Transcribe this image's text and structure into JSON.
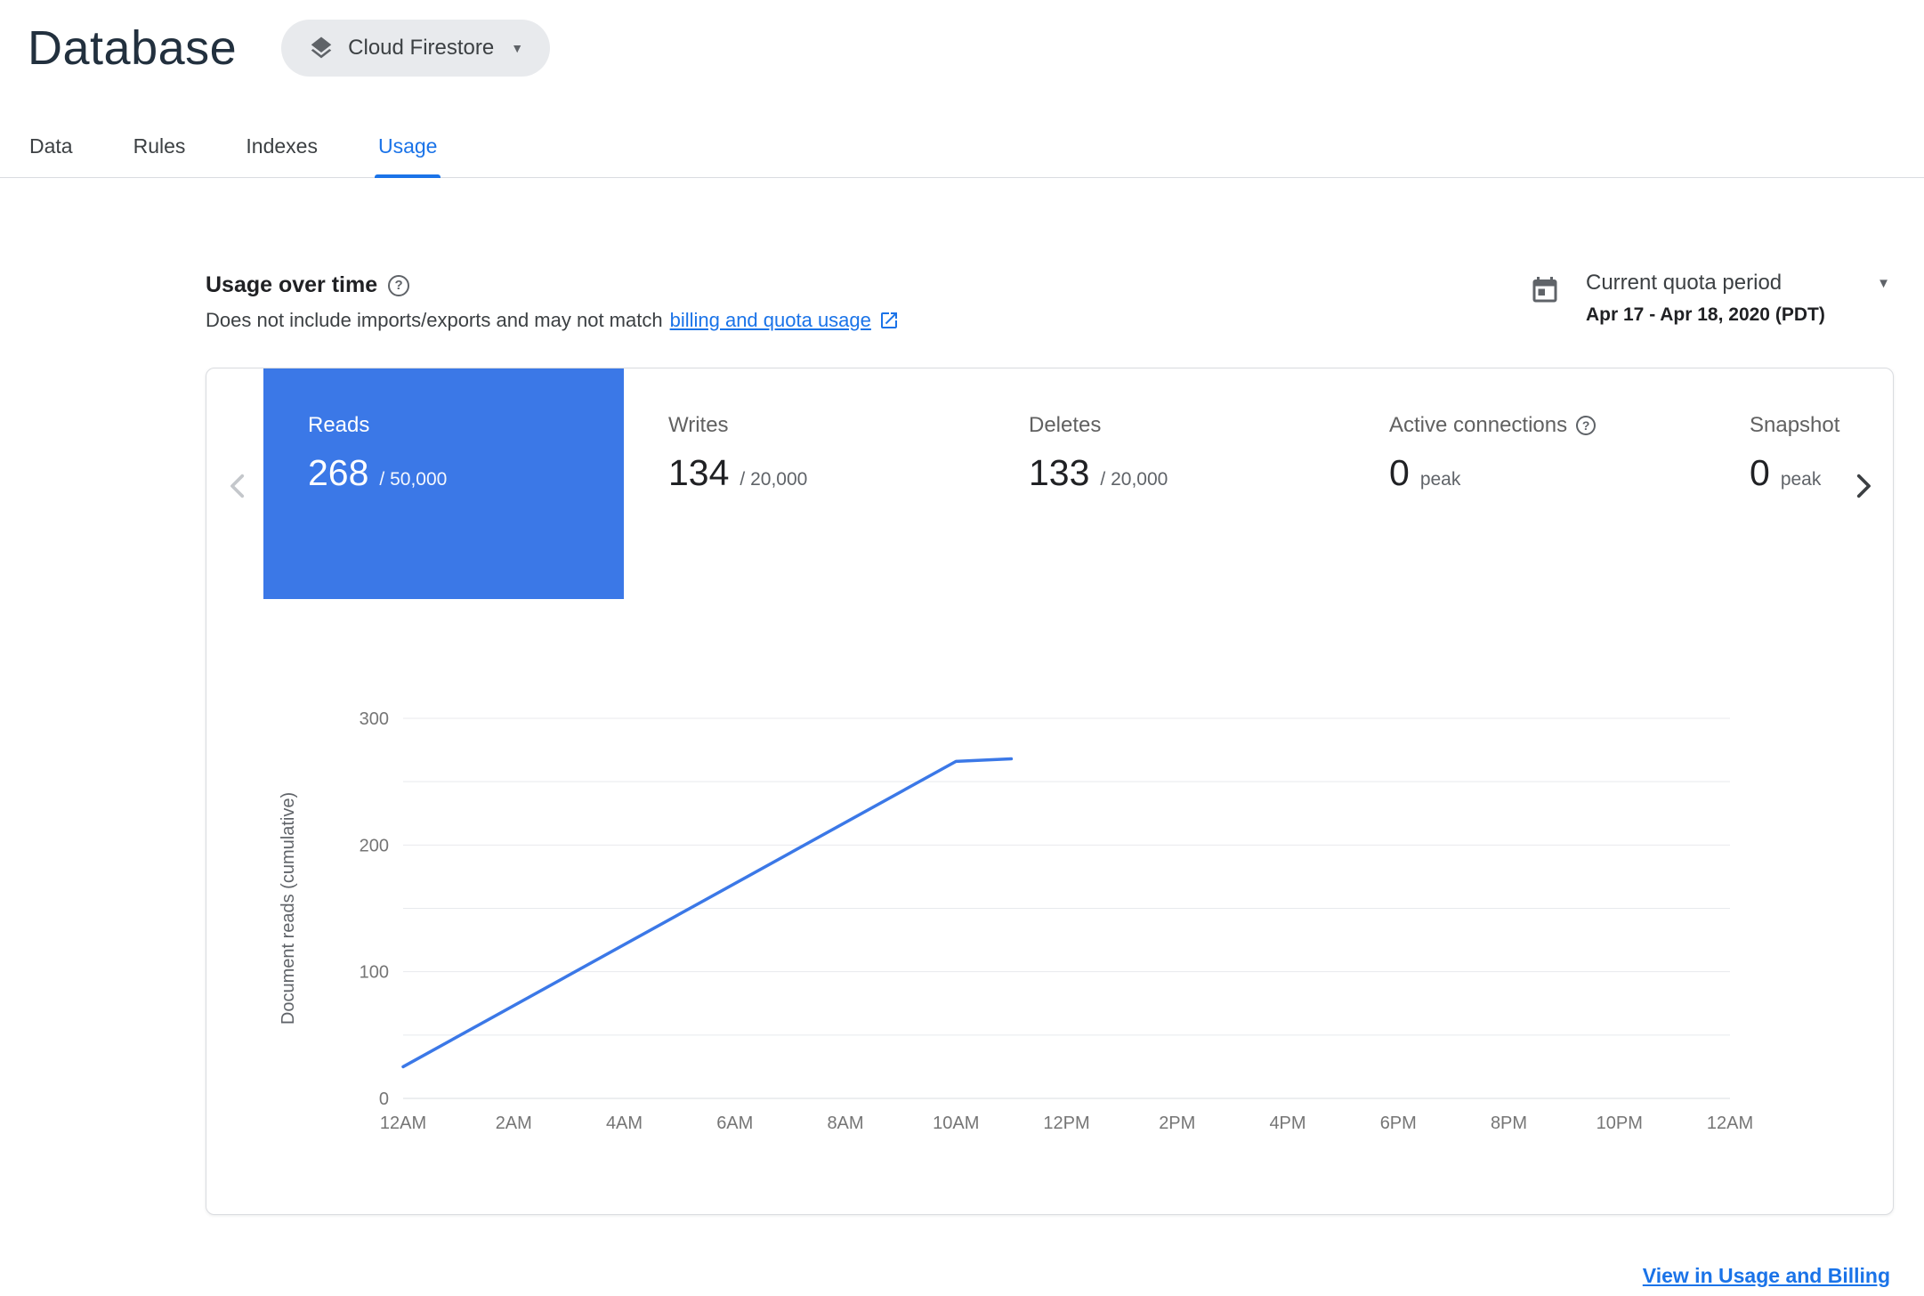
{
  "colors": {
    "primary_blue": "#1a73e8",
    "tile_blue": "#3b78e7",
    "link_blue": "#1a73e8",
    "chart_line": "#3b78e7",
    "text_dark": "#202124",
    "text_gray": "#5f6368"
  },
  "header": {
    "title": "Database",
    "product_selector": {
      "label": "Cloud Firestore"
    }
  },
  "tabs": [
    {
      "label": "Data"
    },
    {
      "label": "Rules"
    },
    {
      "label": "Indexes"
    },
    {
      "label": "Usage"
    }
  ],
  "usage_section": {
    "title": "Usage over time",
    "subtitle_prefix": "Does not include imports/exports and may not match",
    "subtitle_link": "billing and quota usage",
    "quota_period": {
      "label": "Current quota period",
      "range": "Apr 17 - Apr 18, 2020 (PDT)"
    }
  },
  "metrics": [
    {
      "label": "Reads",
      "value": "268",
      "suffix": "/ 50,000"
    },
    {
      "label": "Writes",
      "value": "134",
      "suffix": "/ 20,000"
    },
    {
      "label": "Deletes",
      "value": "133",
      "suffix": "/ 20,000"
    },
    {
      "label": "Active connections",
      "value": "0",
      "suffix": "peak"
    },
    {
      "label": "Snapshot",
      "value": "0",
      "suffix": "peak"
    }
  ],
  "footer": {
    "link_label": "View in Usage and Billing"
  },
  "chart_data": {
    "type": "line",
    "title": "",
    "xlabel": "",
    "ylabel": "Document reads (cumulative)",
    "x_tick_labels": [
      "12AM",
      "2AM",
      "4AM",
      "6AM",
      "8AM",
      "10AM",
      "12PM",
      "2PM",
      "4PM",
      "6PM",
      "8PM",
      "10PM",
      "12AM"
    ],
    "y_ticks": [
      0,
      100,
      200,
      300
    ],
    "ylim": [
      0,
      300
    ],
    "xlim_hours": [
      0,
      24
    ],
    "gridline_step": 50,
    "grid": true,
    "legend": "none",
    "series": [
      {
        "name": "Document reads (cumulative)",
        "points": [
          {
            "hour": 0,
            "value": 25
          },
          {
            "hour": 10,
            "value": 266
          },
          {
            "hour": 11,
            "value": 268
          }
        ]
      }
    ]
  }
}
